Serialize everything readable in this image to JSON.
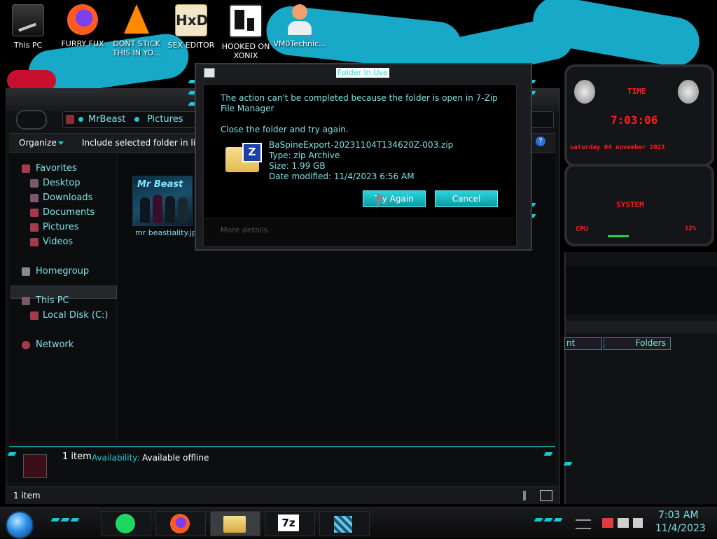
{
  "colors": {
    "accent_cyan": "#1fc9d3",
    "text_cyan": "#7fe0e6",
    "alert_red": "#ff1d1d"
  },
  "desktop": {
    "icons": [
      {
        "label": "This PC",
        "icon": "computer-icon"
      },
      {
        "label": "FURRY FUX",
        "icon": "firefox-icon"
      },
      {
        "label": "DONT STICK THIS IN YO...",
        "icon": "vlc-cone-icon"
      },
      {
        "label": "SEX EDITOR",
        "icon": "hxd-editor-icon"
      },
      {
        "label": "HOOKED ON XONIX",
        "icon": "game-icon"
      },
      {
        "label": "VM0Technic...",
        "icon": "user-doctor-icon"
      }
    ]
  },
  "explorer": {
    "breadcrumb": [
      "MrBeast",
      "Pictures"
    ],
    "toolbar": {
      "organize": "Organize",
      "include": "Include selected folder in libra"
    },
    "nav": {
      "favorites": "Favorites",
      "desktop": "Desktop",
      "downloads": "Downloads",
      "documents": "Documents",
      "pictures": "Pictures",
      "videos": "Videos",
      "homegroup": "Homegroup",
      "this_pc": "This PC",
      "local_disk": "Local Disk (C:)",
      "network": "Network"
    },
    "file": {
      "name": "mr beastiality.jp",
      "thumb_text": "Mr Beast"
    },
    "details": {
      "count": "1 item",
      "availability_label": "Availability:",
      "availability_value": "Available offline"
    },
    "status": "1 item"
  },
  "dialog": {
    "title": "Folder In Use",
    "message": "The action can't be completed because the folder is open in 7-Zip File Manager",
    "instruction": "Close the folder and try again.",
    "file_name": "BaSpineExport-20231104T134620Z-003.zip",
    "file_type": "Type: zip Archive",
    "file_size": "Size: 1.99 GB",
    "file_modified": "Date modified: 11/4/2023 6:56 AM",
    "try_again": "Try Again",
    "cancel": "Cancel",
    "more_details": "More details"
  },
  "gadgets": {
    "clock_label": "TIME",
    "clock_time": "7:03:06",
    "clock_date": "saturday 04 november 2023",
    "system_label": "SYSTEM",
    "cpu_label": "CPU",
    "cpu_value": "12%"
  },
  "background_window": {
    "col_left": "nt",
    "col_folders": "Folders"
  },
  "taskbar": {
    "apps": [
      "spotify-icon",
      "firefox-icon",
      "file-explorer-icon",
      "7zip-icon",
      "network-app-icon"
    ],
    "time": "7:03 AM",
    "date": "11/4/2023"
  }
}
